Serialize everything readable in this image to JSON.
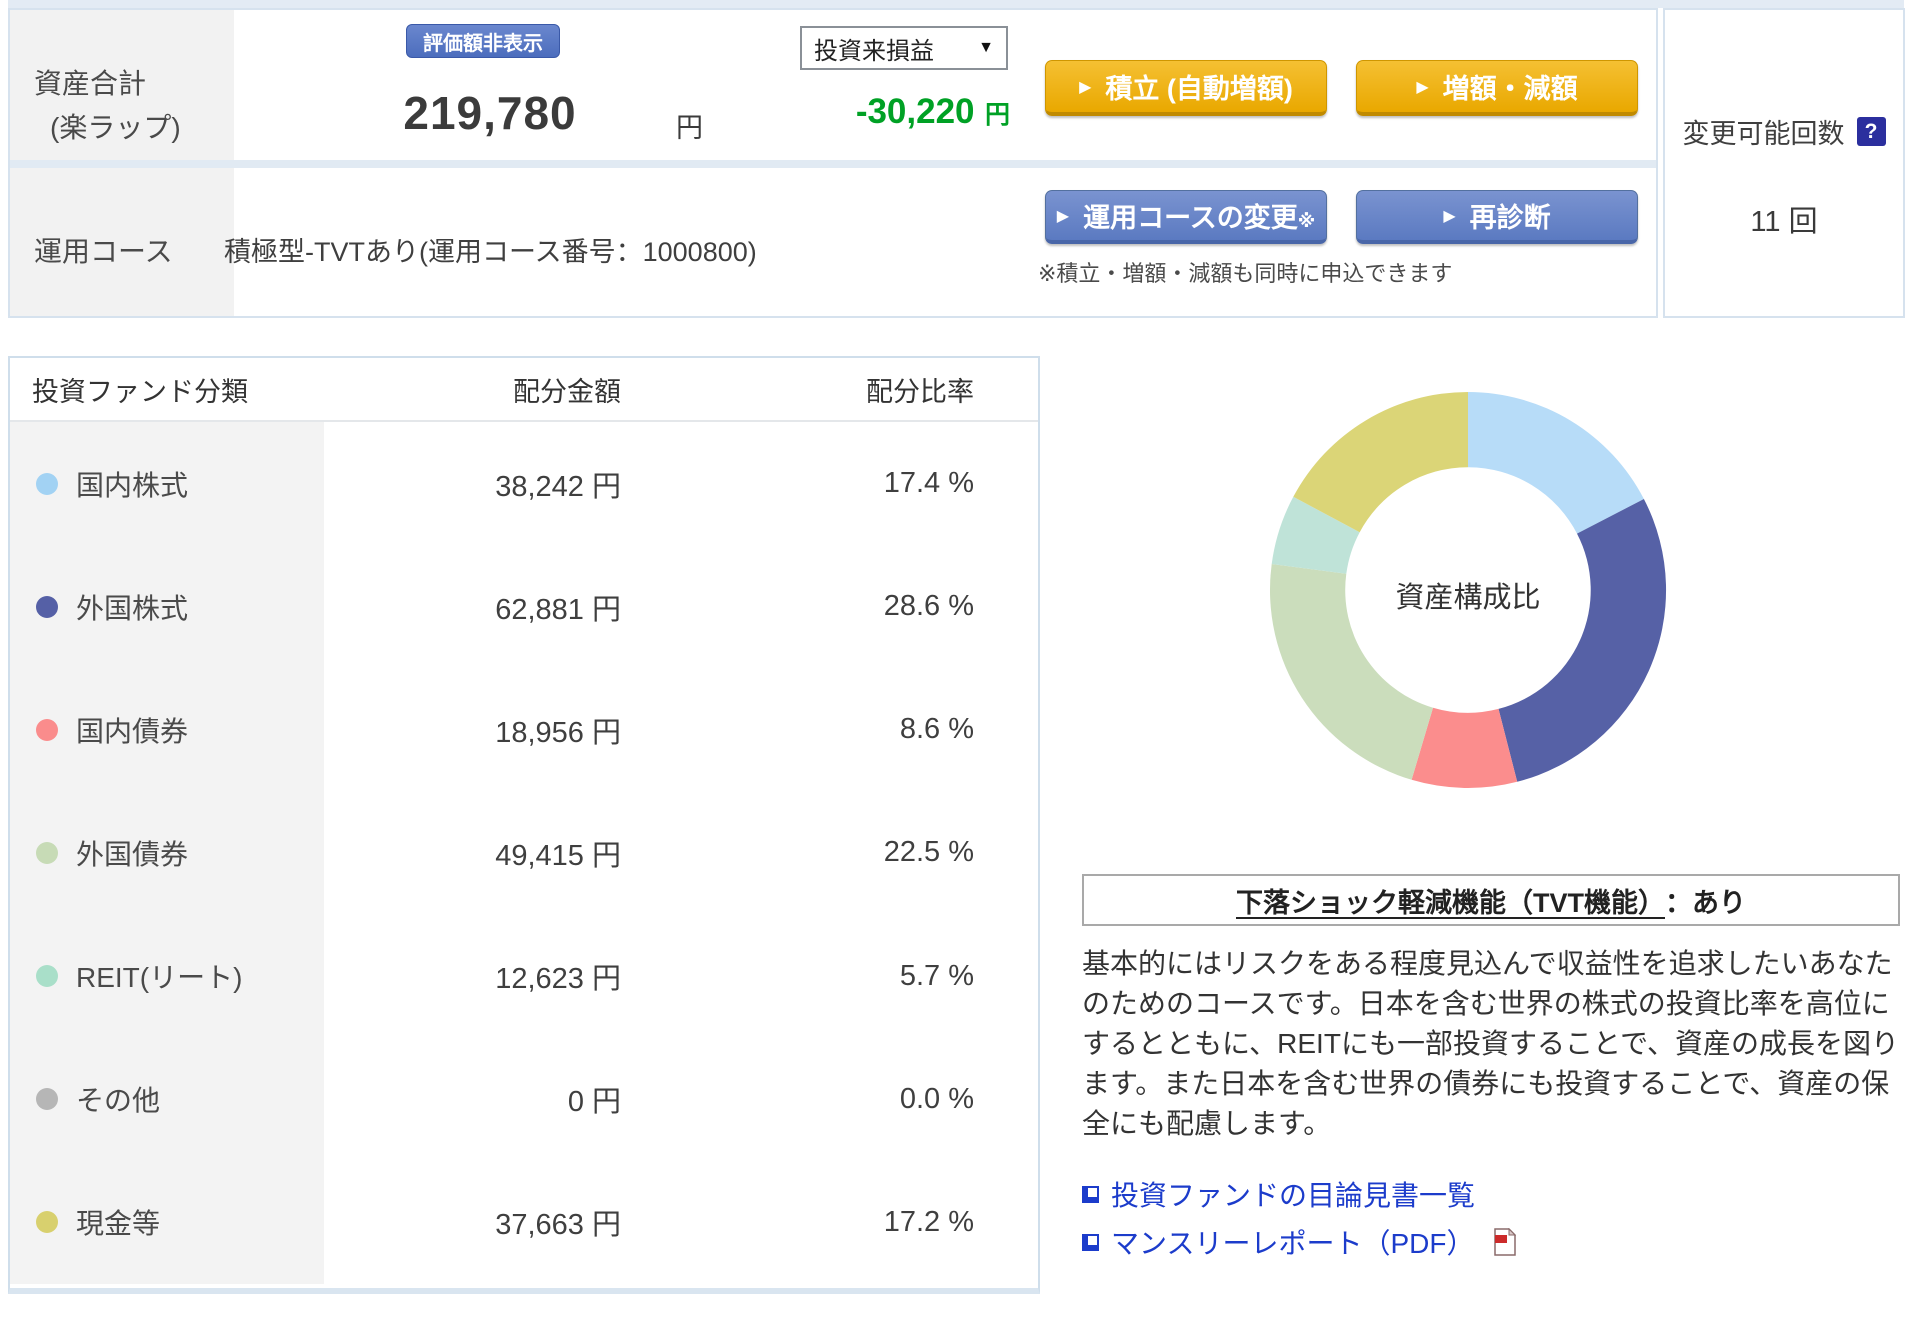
{
  "summary": {
    "asset_label_line1": "資産合計",
    "asset_label_line2": "(楽ラップ)",
    "hide_badge": "評価額非表示",
    "total_value": "219,780",
    "total_unit": "円",
    "pl_select_value": "投資来損益",
    "pl_select_caret": "▼",
    "pl_value": "-30,220",
    "pl_unit": "円",
    "btn_tsumitate": "積立 (自動増額)",
    "btn_zougaku": "増額・減額",
    "btn_course_change": "運用コースの変更",
    "btn_course_change_mark": "※",
    "btn_rediagnosis": "再診断",
    "course_label": "運用コース",
    "course_value": "積極型-TVTあり(運用コース番号：1000800)",
    "apply_note": "※積立・増額・減額も同時に申込できます",
    "button_arrow": "▶"
  },
  "change_panel": {
    "label": "変更可能回数",
    "help": "?",
    "count": "11 回"
  },
  "allocation_table": {
    "headers": [
      "投資ファンド分類",
      "配分金額",
      "配分比率"
    ],
    "rows": [
      {
        "label": "国内株式",
        "dot_color": "#a2d2f3",
        "amount": "38,242 円",
        "ratio": "17.4 %"
      },
      {
        "label": "外国株式",
        "dot_color": "#5560a6",
        "amount": "62,881 円",
        "ratio": "28.6 %"
      },
      {
        "label": "国内債券",
        "dot_color": "#fa8c8c",
        "amount": "18,956 円",
        "ratio": "8.6 %"
      },
      {
        "label": "外国債券",
        "dot_color": "#c7dbb6",
        "amount": "49,415 円",
        "ratio": "22.5 %"
      },
      {
        "label": "REIT(リート)",
        "dot_color": "#a9dfc9",
        "amount": "12,623 円",
        "ratio": "5.7 %"
      },
      {
        "label": "その他",
        "dot_color": "#b6b6b6",
        "amount": "0 円",
        "ratio": "0.0 %"
      },
      {
        "label": "現金等",
        "dot_color": "#d8d06e",
        "amount": "37,663 円",
        "ratio": "17.2 %"
      }
    ]
  },
  "chart_data": {
    "type": "pie",
    "subtype": "donut",
    "title": "資産構成比",
    "categories": [
      "国内株式",
      "外国株式",
      "国内債券",
      "外国債券",
      "REIT(リート)",
      "その他",
      "現金等"
    ],
    "values": [
      17.4,
      28.6,
      8.6,
      22.5,
      5.7,
      0.0,
      17.2
    ],
    "amounts_yen": [
      38242,
      62881,
      18956,
      49415,
      12623,
      0,
      37663
    ],
    "colors": [
      "#b7dcf8",
      "#5661a6",
      "#fb8d8d",
      "#cbddbc",
      "#bfe3d8",
      "#b5b5b5",
      "#dbd577"
    ],
    "start_angle_deg": 0,
    "direction": "clockwise",
    "inner_radius_ratio": 0.62,
    "legend_position": "table-left"
  },
  "course_info": {
    "tvt_title_underlined": "下落ショック軽減機能（TVT機能）",
    "tvt_title_rest": "：あり",
    "description": "基本的にはリスクをある程度見込んで収益性を追求したいあなたのためのコースです。日本を含む世界の株式の投資比率を高位にするとともに、REITにも一部投資することで、資産の成長を図ります。また日本を含む世界の債券にも投資することで、資産の保全にも配慮します。",
    "links": [
      {
        "label": "投資ファンドの目論見書一覧",
        "pdf": false
      },
      {
        "label": "マンスリーレポート（PDF）",
        "pdf": true
      }
    ]
  }
}
